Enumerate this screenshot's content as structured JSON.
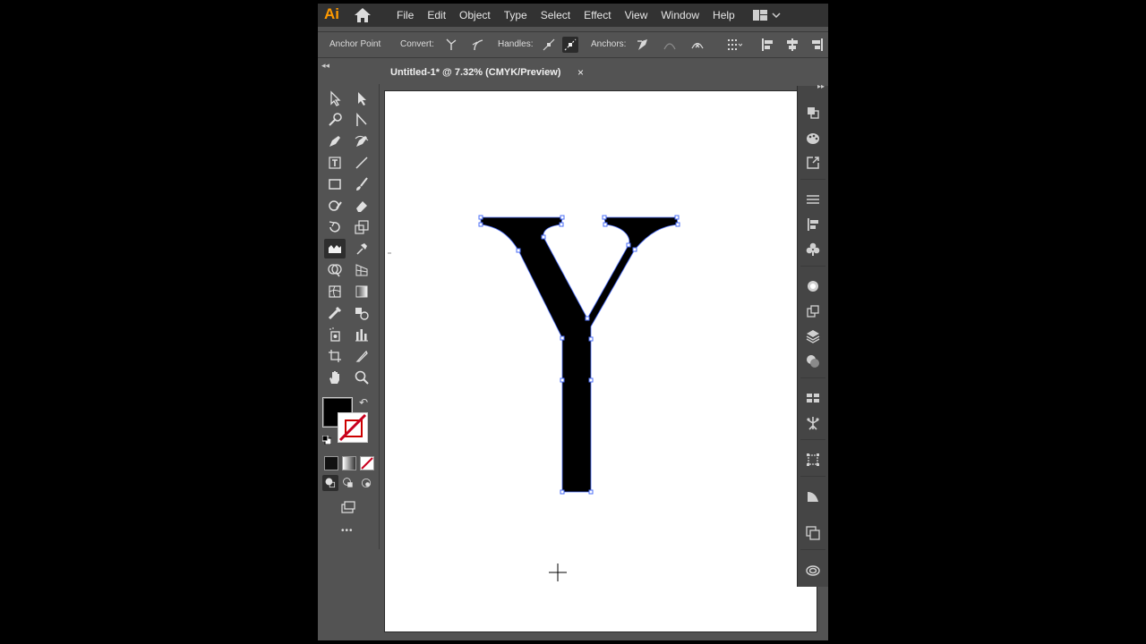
{
  "app": {
    "logo": "Ai"
  },
  "menu": [
    "File",
    "Edit",
    "Object",
    "Type",
    "Select",
    "Effect",
    "View",
    "Window",
    "Help"
  ],
  "control": {
    "anchor_point": "Anchor Point",
    "convert": "Convert:",
    "handles": "Handles:",
    "anchors": "Anchors:"
  },
  "document": {
    "tab_title": "Untitled-1* @ 7.32% (CMYK/Preview)",
    "close_glyph": "×"
  },
  "tools": [
    "selection-tool",
    "direct-selection-tool",
    "magic-wand-tool",
    "lasso-tool",
    "pen-tool",
    "curvature-tool",
    "type-tool",
    "line-segment-tool",
    "rectangle-tool",
    "paintbrush-tool",
    "shaper-tool",
    "eraser-tool",
    "rotate-tool",
    "scale-tool",
    "width-tool",
    "puppet-warp-tool",
    "shape-builder-tool",
    "perspective-grid-tool",
    "mesh-tool",
    "gradient-tool",
    "eyedropper-tool",
    "blend-tool",
    "symbol-sprayer-tool",
    "column-graph-tool",
    "artboard-tool",
    "slice-tool",
    "hand-tool",
    "zoom-tool"
  ],
  "colors": {
    "fill": "#000000",
    "stroke": "none",
    "accent": "#ff9a00",
    "path_outline": "#4a6cf7"
  },
  "more_tools_glyph": "•••",
  "dock_panels": [
    "properties-icon",
    "color-guide-icon",
    "export-icon",
    "align-icon",
    "align-left-icon",
    "symbols-icon",
    "brushes-icon",
    "libraries-icon",
    "layers-icon",
    "appearance-icon",
    "swatches-icon",
    "pathfinder-icon",
    "transform-icon",
    "transparency-icon",
    "artboards-icon",
    "cc-libraries-icon"
  ]
}
